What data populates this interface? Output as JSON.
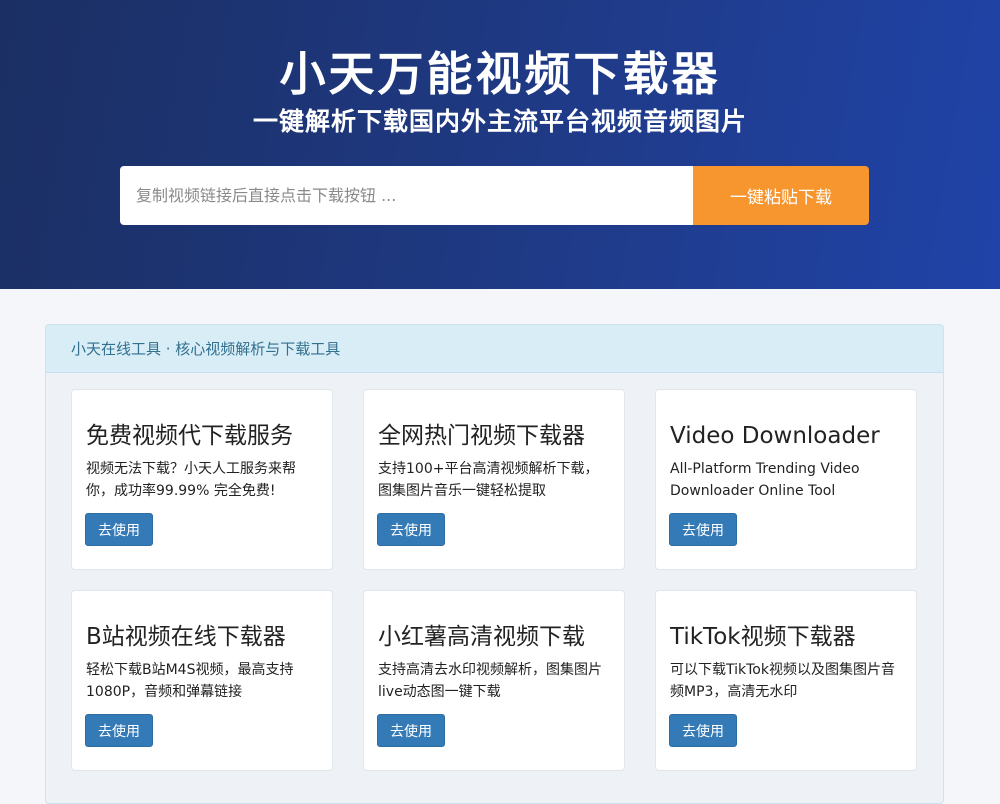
{
  "hero": {
    "title": "小天万能视频下载器",
    "subtitle": "一键解析下载国内外主流平台视频音频图片"
  },
  "search": {
    "placeholder": "复制视频链接后直接点击下载按钮 ...",
    "value": "",
    "button_label": "一键粘贴下载"
  },
  "panel": {
    "title": "小天在线工具 · 核心视频解析与下载工具"
  },
  "cards": [
    {
      "title": "免费视频代下载服务",
      "description": "视频无法下载？小天人工服务来帮你，成功率99.99% 完全免费!",
      "button_label": "去使用"
    },
    {
      "title": "全网热门视频下载器",
      "description": "支持100+平台高清视频解析下载，图集图片音乐一键轻松提取",
      "button_label": "去使用"
    },
    {
      "title": "Video Downloader",
      "description": "All-Platform Trending Video Downloader Online Tool",
      "button_label": "去使用"
    },
    {
      "title": "B站视频在线下载器",
      "description": "轻松下载B站M4S视频，最高支持1080P，音频和弹幕链接",
      "button_label": "去使用"
    },
    {
      "title": "小红薯高清视频下载",
      "description": "支持高清去水印视频解析，图集图片 live动态图一键下载",
      "button_label": "去使用"
    },
    {
      "title": "TikTok视频下载器",
      "description": "可以下载TikTok视频以及图集图片音频MP3，高清无水印",
      "button_label": "去使用"
    }
  ],
  "colors": {
    "accent_orange": "#f7962e",
    "primary_blue": "#337ab7",
    "hero_dark": "#1b2f63",
    "panel_header_bg": "#d9edf7",
    "panel_header_text": "#31708f"
  }
}
